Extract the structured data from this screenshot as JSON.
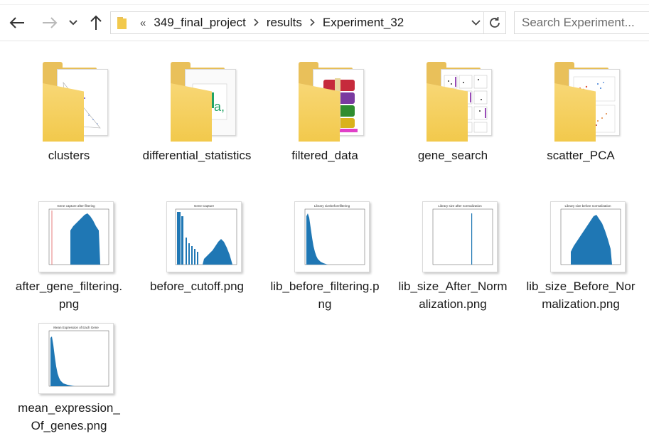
{
  "nav": {
    "back_icon": "arrow-left-icon",
    "forward_icon": "arrow-right-icon",
    "recent_icon": "chevron-down-icon",
    "up_icon": "arrow-up-icon",
    "overflow_marker": "«",
    "breadcrumbs": [
      "349_final_project",
      "results",
      "Experiment_32"
    ],
    "refresh_icon": "refresh-icon"
  },
  "search": {
    "placeholder": "Search Experiment..."
  },
  "folders": [
    {
      "name": "clusters"
    },
    {
      "name": "differential_statistics"
    },
    {
      "name": "filtered_data"
    },
    {
      "name": "gene_search"
    },
    {
      "name": "scatter_PCA"
    }
  ],
  "images": [
    {
      "name": "after_gene_filtering.png",
      "plot_title": "Gene capture after filtering"
    },
    {
      "name": "before_cutoff.png",
      "plot_title": "Gene Capture"
    },
    {
      "name": "lib_before_filtering.png",
      "plot_title": "Library sizebeforefiltering"
    },
    {
      "name": "lib_size_After_Normalization.png",
      "plot_title": "Library size after normalization"
    },
    {
      "name": "lib_size_Before_Normalization.png",
      "plot_title": "Library size before normalization"
    },
    {
      "name": "mean_expression_Of_genes.png",
      "plot_title": "Mean Expression of Each Gene"
    }
  ],
  "colors": {
    "folder": "#f2c94c",
    "bar": "#1f77b4",
    "accent": "#0078d7"
  }
}
